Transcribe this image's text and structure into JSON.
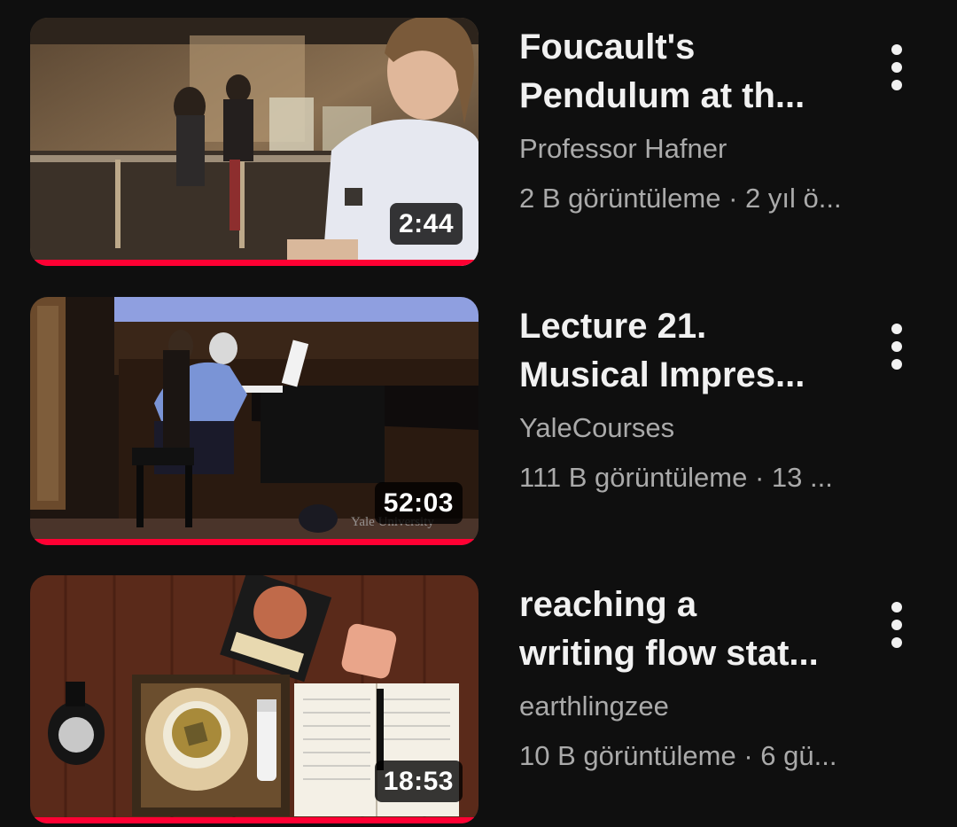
{
  "videos": [
    {
      "title_line1": "Foucault's",
      "title_line2": "Pendulum at th...",
      "channel": "Professor Hafner",
      "stats": "2 B görüntüleme · 2 yıl ö...",
      "duration": "2:44",
      "watched_fraction": 1.0,
      "thumbnail_subject": "man-in-museum-pendulum-exhibit"
    },
    {
      "title_line1": "Lecture 21.",
      "title_line2": "Musical Impres...",
      "channel": "YaleCourses",
      "stats": "111 B görüntüleme · 13 ...",
      "duration": "52:03",
      "watched_fraction": 1.0,
      "thumbnail_subject": "pianist-on-stage",
      "watermark": "Yale University"
    },
    {
      "title_line1": "reaching a",
      "title_line2": "writing flow stat...",
      "channel": "earthlingzee",
      "stats": "10 B görüntüleme · 6 gü...",
      "duration": "18:53",
      "watched_fraction": 1.0,
      "thumbnail_subject": "desk-with-tea-and-notebook"
    }
  ],
  "icons": {
    "more": "more-vert-icon"
  },
  "colors": {
    "background": "#0f0f0f",
    "progress": "#ff0033",
    "secondary_text": "#aaaaaa"
  }
}
